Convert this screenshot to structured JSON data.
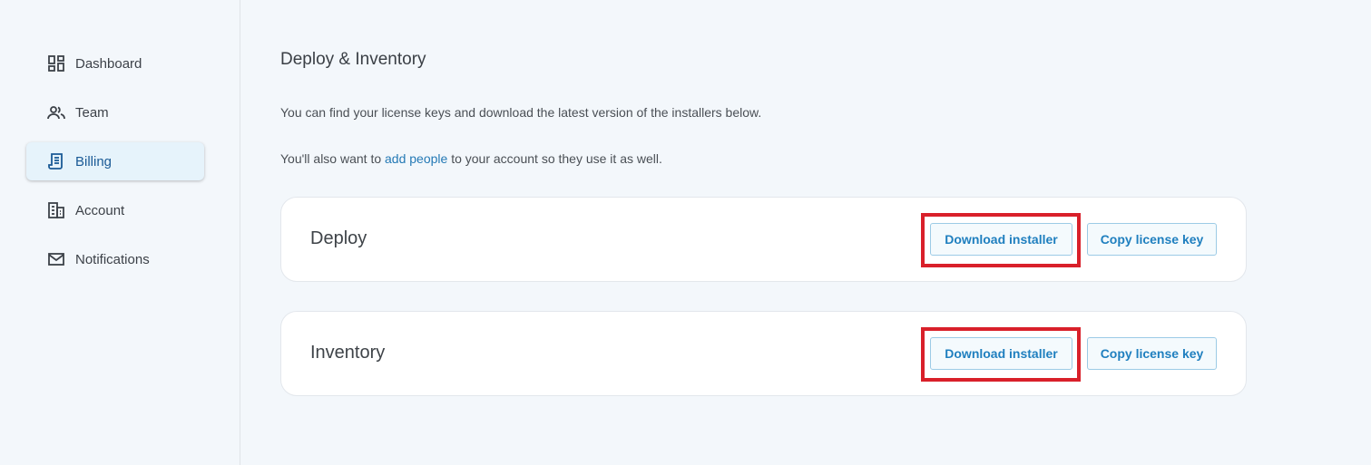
{
  "sidebar": {
    "items": [
      {
        "label": "Dashboard",
        "icon": "dashboard-icon",
        "active": false
      },
      {
        "label": "Team",
        "icon": "people-icon",
        "active": false
      },
      {
        "label": "Billing",
        "icon": "receipt-icon",
        "active": true
      },
      {
        "label": "Account",
        "icon": "building-icon",
        "active": false
      },
      {
        "label": "Notifications",
        "icon": "mail-icon",
        "active": false
      }
    ]
  },
  "main": {
    "title": "Deploy & Inventory",
    "paragraph1": "You can find your license keys and download the latest version of the installers below.",
    "paragraph2_prefix": "You'll also want to ",
    "paragraph2_link": "add people",
    "paragraph2_suffix": " to your account so they use it as well.",
    "cards": [
      {
        "title": "Deploy",
        "download_label": "Download installer",
        "copy_label": "Copy license key"
      },
      {
        "title": "Inventory",
        "download_label": "Download installer",
        "copy_label": "Copy license key"
      }
    ]
  },
  "colors": {
    "accent": "#1f7fbf",
    "highlight": "#d9202a",
    "active_bg": "#e6f3fb",
    "page_bg": "#f3f7fb"
  }
}
